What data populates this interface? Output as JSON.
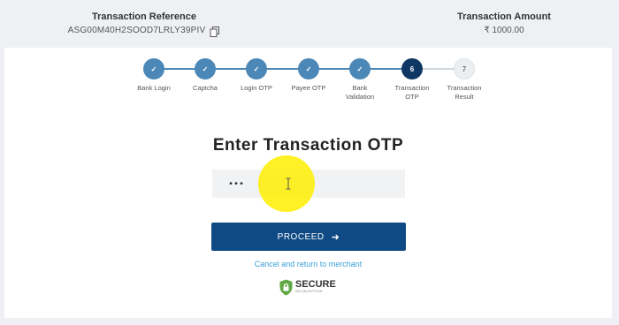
{
  "header": {
    "reference_title": "Transaction Reference",
    "reference_value": "ASG00M40H2SOOD7LRLY39PIV",
    "amount_title": "Transaction Amount",
    "amount_value": "₹ 1000.00"
  },
  "stepper": {
    "steps": [
      {
        "label": "Bank Login",
        "state": "done",
        "marker": "✓"
      },
      {
        "label": "Captcha",
        "state": "done",
        "marker": "✓"
      },
      {
        "label": "Login OTP",
        "state": "done",
        "marker": "✓"
      },
      {
        "label": "Payee OTP",
        "state": "done",
        "marker": "✓"
      },
      {
        "label": "Bank Validation",
        "state": "done",
        "marker": "✓"
      },
      {
        "label": "Transaction OTP",
        "state": "active",
        "marker": "6"
      },
      {
        "label": "Transaction Result",
        "state": "pending",
        "marker": "7"
      }
    ],
    "colors": {
      "done": "#4b88b8",
      "active": "#0e3763",
      "pending": "#eceef0"
    }
  },
  "otp": {
    "title": "Enter Transaction OTP",
    "input_value": "•••"
  },
  "actions": {
    "proceed_label": "PROCEED",
    "proceed_icon": "right-arrow",
    "cancel_label": "Cancel and return to merchant"
  },
  "secure_badge": {
    "label": "SECURE",
    "sub_label": "SSL ENCRYPTION"
  },
  "colors": {
    "primary": "#0f4a85",
    "link": "#3aa0d8",
    "highlight": "#ffee00"
  }
}
